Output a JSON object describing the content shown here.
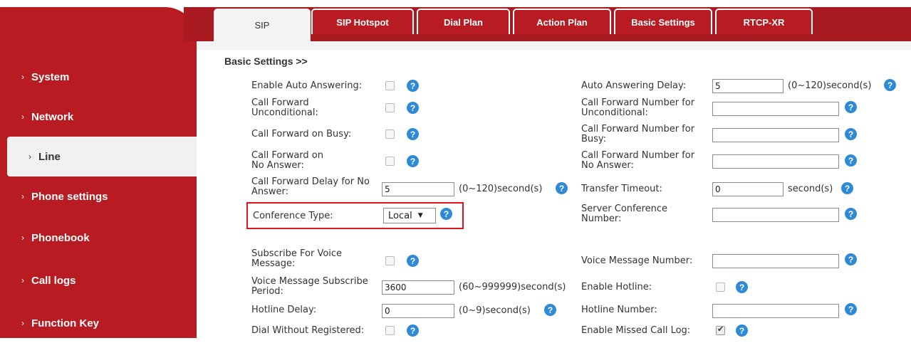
{
  "sidebar": {
    "items": [
      {
        "label": "System"
      },
      {
        "label": "Network"
      },
      {
        "label": "Line"
      },
      {
        "label": "Phone settings"
      },
      {
        "label": "Phonebook"
      },
      {
        "label": "Call logs"
      },
      {
        "label": "Function Key"
      }
    ],
    "chevron": "›"
  },
  "tabs": [
    "SIP",
    "SIP Hotspot",
    "Dial Plan",
    "Action Plan",
    "Basic Settings",
    "RTCP-XR"
  ],
  "section_title": "Basic Settings >>",
  "help_glyph": "?",
  "form": {
    "enable_auto_answering": {
      "label": "Enable Auto Answering:",
      "checked": false
    },
    "auto_answering_delay": {
      "label": "Auto Answering Delay:",
      "value": "5",
      "unit": "(0~120)second(s)"
    },
    "cf_unconditional": {
      "label": "Call Forward Unconditional:",
      "checked": false
    },
    "cf_number_unconditional": {
      "label": "Call Forward Number for Unconditional:",
      "value": ""
    },
    "cf_busy": {
      "label": "Call Forward on Busy:",
      "checked": false
    },
    "cf_number_busy": {
      "label": "Call Forward Number for Busy:",
      "value": ""
    },
    "cf_no_answer": {
      "label": "Call Forward on No Answer:",
      "checked": false
    },
    "cf_number_no_answer": {
      "label": "Call Forward Number for No Answer:",
      "value": ""
    },
    "cf_delay_no_answer": {
      "label": "Call Forward Delay for No Answer:",
      "value": "5",
      "unit": "(0~120)second(s)"
    },
    "transfer_timeout": {
      "label": "Transfer Timeout:",
      "value": "0",
      "unit": "second(s)"
    },
    "conference_type": {
      "label": "Conference Type:",
      "value": "Local",
      "arrow": "▼"
    },
    "server_conference_number": {
      "label": "Server Conference Number:",
      "value": ""
    },
    "subscribe_voice_message": {
      "label": "Subscribe For Voice Message:",
      "checked": false
    },
    "voice_message_number": {
      "label": "Voice Message Number:",
      "value": ""
    },
    "vm_subscribe_period": {
      "label": "Voice Message Subscribe Period:",
      "value": "3600",
      "unit": "(60~999999)second(s)"
    },
    "enable_hotline": {
      "label": "Enable Hotline:",
      "checked": false
    },
    "hotline_delay": {
      "label": "Hotline Delay:",
      "value": "0",
      "unit": "(0~9)second(s)"
    },
    "hotline_number": {
      "label": "Hotline Number:",
      "value": ""
    },
    "dial_without_registered": {
      "label": "Dial Without Registered:",
      "checked": false
    },
    "enable_missed_call_log": {
      "label": "Enable Missed Call Log:",
      "checked": true
    }
  },
  "colors": {
    "brand_red": "#b81c22",
    "help_blue": "#2f8ad6",
    "highlight": "#e0141d"
  }
}
